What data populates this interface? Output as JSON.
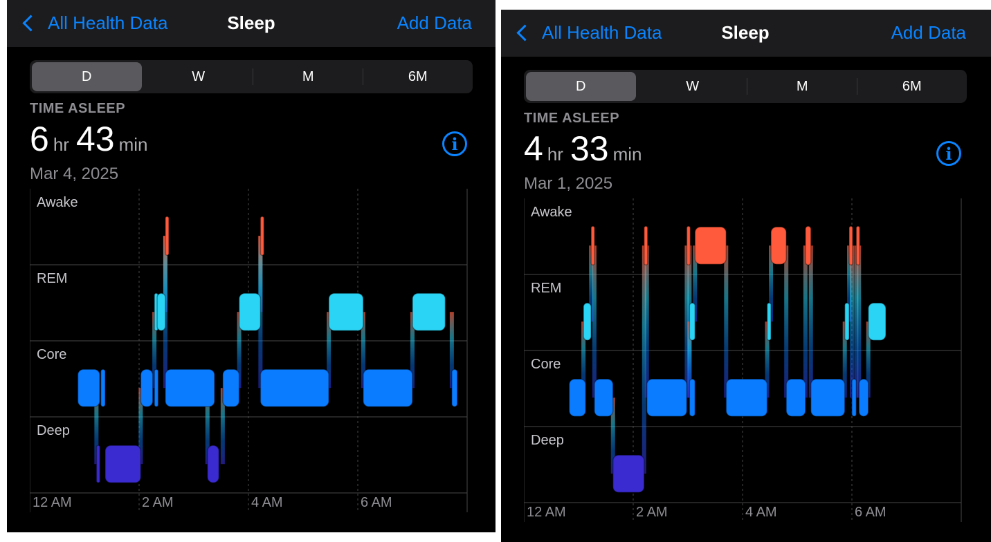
{
  "panels": [
    {
      "nav": {
        "back_label": "All Health Data",
        "title": "Sleep",
        "add_label": "Add Data"
      },
      "segments": [
        "D",
        "W",
        "M",
        "6M"
      ],
      "selected_segment": "D",
      "metric_label": "TIME ASLEEP",
      "hours": "6",
      "hours_unit": "hr",
      "minutes": "43",
      "minutes_unit": "min",
      "date": "Mar 4, 2025",
      "chart": {
        "stage_labels": [
          "Awake",
          "REM",
          "Core",
          "Deep"
        ],
        "x_ticks": [
          "12 AM",
          "2 AM",
          "4 AM",
          "6 AM"
        ],
        "segments": [
          {
            "stage": "Core",
            "start": 0.88,
            "end": 1.28
          },
          {
            "stage": "Core",
            "start": 1.3,
            "end": 1.38
          },
          {
            "stage": "Deep",
            "start": 1.22,
            "end": 1.27
          },
          {
            "stage": "Deep",
            "start": 1.38,
            "end": 2.03
          },
          {
            "stage": "Core",
            "start": 2.03,
            "end": 2.25
          },
          {
            "stage": "Core",
            "start": 2.28,
            "end": 2.35
          },
          {
            "stage": "REM",
            "start": 2.28,
            "end": 2.33
          },
          {
            "stage": "REM",
            "start": 2.33,
            "end": 2.48
          },
          {
            "stage": "Awake",
            "start": 2.48,
            "end": 2.53
          },
          {
            "stage": "Core",
            "start": 2.48,
            "end": 3.38
          },
          {
            "stage": "Deep",
            "start": 3.25,
            "end": 3.46
          },
          {
            "stage": "Core",
            "start": 3.53,
            "end": 3.83
          },
          {
            "stage": "REM",
            "start": 3.83,
            "end": 4.22
          },
          {
            "stage": "Awake",
            "start": 4.22,
            "end": 4.27
          },
          {
            "stage": "Core",
            "start": 4.22,
            "end": 5.47
          },
          {
            "stage": "REM",
            "start": 5.47,
            "end": 6.1
          },
          {
            "stage": "Core",
            "start": 6.1,
            "end": 7.0
          },
          {
            "stage": "REM",
            "start": 7.0,
            "end": 7.6
          },
          {
            "stage": "Core",
            "start": 7.72,
            "end": 7.82
          }
        ]
      }
    },
    {
      "nav": {
        "back_label": "All Health Data",
        "title": "Sleep",
        "add_label": "Add Data"
      },
      "segments": [
        "D",
        "W",
        "M",
        "6M"
      ],
      "selected_segment": "D",
      "metric_label": "TIME ASLEEP",
      "hours": "4",
      "hours_unit": "hr",
      "minutes": "33",
      "minutes_unit": "min",
      "date": "Mar 1, 2025",
      "chart": {
        "stage_labels": [
          "Awake",
          "REM",
          "Core",
          "Deep"
        ],
        "x_ticks": [
          "12 AM",
          "2 AM",
          "4 AM",
          "6 AM"
        ],
        "segments": [
          {
            "stage": "Core",
            "start": 0.83,
            "end": 1.13
          },
          {
            "stage": "REM",
            "start": 1.09,
            "end": 1.23
          },
          {
            "stage": "Awake",
            "start": 1.23,
            "end": 1.29
          },
          {
            "stage": "Core",
            "start": 1.29,
            "end": 1.63
          },
          {
            "stage": "Deep",
            "start": 1.63,
            "end": 2.2
          },
          {
            "stage": "Awake",
            "start": 2.2,
            "end": 2.25
          },
          {
            "stage": "Core",
            "start": 2.25,
            "end": 2.98
          },
          {
            "stage": "Awake",
            "start": 2.98,
            "end": 3.03
          },
          {
            "stage": "Core",
            "start": 3.03,
            "end": 3.13
          },
          {
            "stage": "REM",
            "start": 3.03,
            "end": 3.13
          },
          {
            "stage": "Awake",
            "start": 3.13,
            "end": 3.7
          },
          {
            "stage": "Core",
            "start": 3.7,
            "end": 4.45
          },
          {
            "stage": "REM",
            "start": 4.45,
            "end": 4.52
          },
          {
            "stage": "Awake",
            "start": 4.52,
            "end": 4.8
          },
          {
            "stage": "Core",
            "start": 4.8,
            "end": 5.15
          },
          {
            "stage": "Awake",
            "start": 5.15,
            "end": 5.25
          },
          {
            "stage": "Core",
            "start": 5.25,
            "end": 5.87
          },
          {
            "stage": "REM",
            "start": 5.87,
            "end": 5.95
          },
          {
            "stage": "Awake",
            "start": 5.95,
            "end": 6.0
          },
          {
            "stage": "Core",
            "start": 6.0,
            "end": 6.08
          },
          {
            "stage": "Awake",
            "start": 6.08,
            "end": 6.13
          },
          {
            "stage": "Core",
            "start": 6.13,
            "end": 6.3
          },
          {
            "stage": "REM",
            "start": 6.3,
            "end": 6.62
          }
        ]
      }
    }
  ],
  "colors": {
    "Awake": "#ff5a3c",
    "REM": "#2ad4f5",
    "Core": "#0a7cff",
    "Deep": "#3a2bd0",
    "accent": "#0a84ff"
  }
}
